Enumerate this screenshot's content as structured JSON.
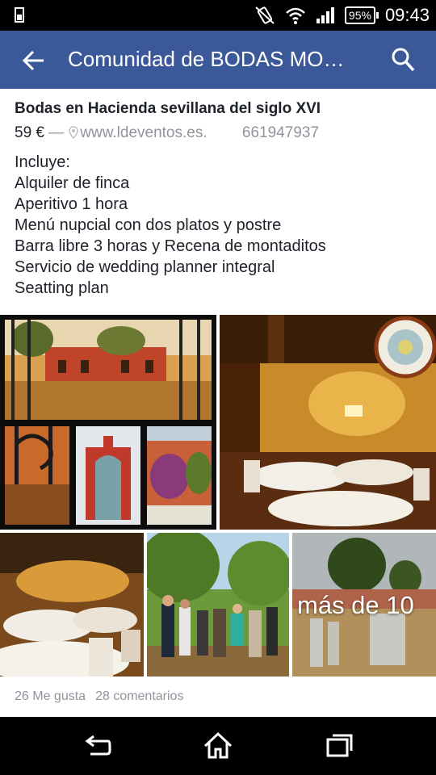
{
  "status_bar": {
    "time": "09:43",
    "battery": "95%"
  },
  "app_bar": {
    "title": "Comunidad de BODAS MO…"
  },
  "post": {
    "title": "Bodas en Hacienda sevillana del siglo XVI",
    "price": "59 €",
    "separator": "—",
    "location": "www.ldeventos.es.",
    "phone": "661947937",
    "description": [
      "Incluye:",
      "Alquiler de finca",
      "Aperitivo 1 hora",
      "Menú nupcial con dos platos y postre",
      "Barra libre 3 horas y Recena de montaditos",
      "Servicio de wedding planner integral",
      "Seatting plan"
    ],
    "more_photos": "más de 10",
    "likes": "26 Me gusta",
    "comments": "28 comentarios"
  },
  "colors": {
    "app_bar": "#3b5998",
    "text": "#1d2129",
    "muted": "#90949c"
  },
  "icons": [
    "back-arrow-icon",
    "search-icon",
    "map-pin-icon",
    "nav-back-icon",
    "nav-home-icon",
    "nav-recents-icon"
  ]
}
